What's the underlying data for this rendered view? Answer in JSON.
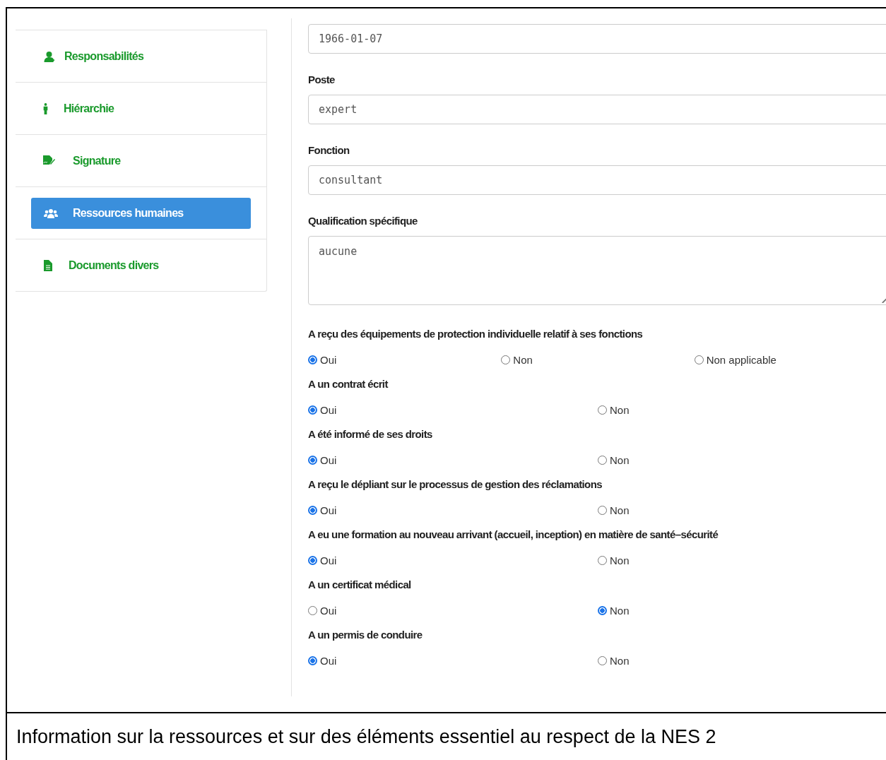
{
  "sidebar": {
    "items": [
      {
        "label": "Responsabilités",
        "selected": false
      },
      {
        "label": "Hiérarchie",
        "selected": false
      },
      {
        "label": "Signature",
        "selected": false
      },
      {
        "label": "Ressources humaines",
        "selected": true
      },
      {
        "label": "Documents divers",
        "selected": false
      }
    ]
  },
  "form": {
    "fields": [
      {
        "kind": "input",
        "value": "1966-01-07"
      },
      {
        "kind": "input",
        "label": "Poste",
        "value": "expert"
      },
      {
        "kind": "input",
        "label": "Fonction",
        "value": "consultant"
      },
      {
        "kind": "textarea",
        "label": "Qualification spécifique",
        "value": "aucune"
      }
    ],
    "questions": [
      {
        "label": "A reçu des équipements de protection individuelle relatif à ses fonctions",
        "options": [
          {
            "label": "Oui",
            "selected": true
          },
          {
            "label": "Non",
            "selected": false
          },
          {
            "label": "Non applicable",
            "selected": false
          }
        ]
      },
      {
        "label": "A un contrat écrit",
        "options": [
          {
            "label": "Oui",
            "selected": true
          },
          {
            "label": "Non",
            "selected": false
          }
        ]
      },
      {
        "label": "A été informé de ses droits",
        "options": [
          {
            "label": "Oui",
            "selected": true
          },
          {
            "label": "Non",
            "selected": false
          }
        ]
      },
      {
        "label": "A reçu le dépliant sur le processus de gestion des réclamations",
        "options": [
          {
            "label": "Oui",
            "selected": true
          },
          {
            "label": "Non",
            "selected": false
          }
        ]
      },
      {
        "label": "A eu une formation au nouveau arrivant (accueil, inception) en matière de santé–sécurité",
        "options": [
          {
            "label": "Oui",
            "selected": true
          },
          {
            "label": "Non",
            "selected": false
          }
        ]
      },
      {
        "label": "A un certificat médical",
        "options": [
          {
            "label": "Oui",
            "selected": false
          },
          {
            "label": "Non",
            "selected": true
          }
        ]
      },
      {
        "label": "A un permis de conduire",
        "options": [
          {
            "label": "Oui",
            "selected": true
          },
          {
            "label": "Non",
            "selected": false
          }
        ]
      }
    ]
  },
  "caption": "Information sur la ressources et sur des éléments essentiel au respect de la NES 2"
}
